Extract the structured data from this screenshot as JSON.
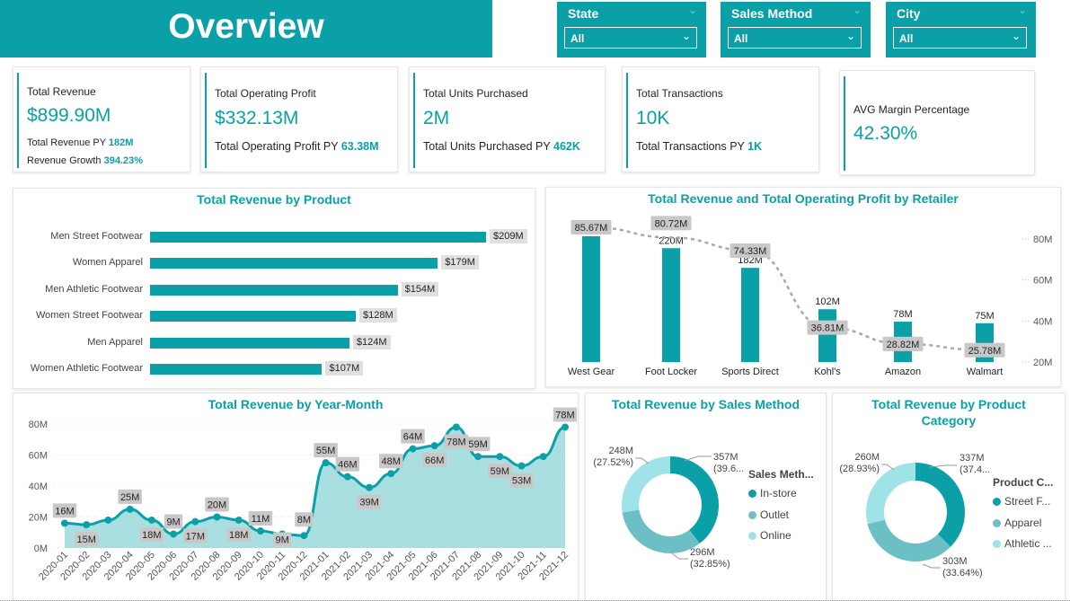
{
  "title": "Overview",
  "colors": {
    "accent": "#0ba0a7",
    "teal_mid": "#6cbfc4",
    "teal_light": "#9fe3e8",
    "label_bg": "#c8c8c8"
  },
  "filters": [
    {
      "label": "State",
      "value": "All"
    },
    {
      "label": "Sales Method",
      "value": "All"
    },
    {
      "label": "City",
      "value": "All"
    }
  ],
  "kpis": {
    "revenue": {
      "title": "Total Revenue",
      "value": "$899.90M",
      "sub1_label": "Total Revenue PY",
      "sub1_value": "182M",
      "sub2_label": "Revenue Growth",
      "sub2_value": "394.23%"
    },
    "profit": {
      "title": "Total Operating Profit",
      "value": "$332.13M",
      "sub_label": "Total Operating Profit PY",
      "sub_value": "63.38M"
    },
    "units": {
      "title": "Total Units Purchased",
      "value": "2M",
      "sub_label": "Total Units Purchased PY",
      "sub_value": "462K"
    },
    "transactions": {
      "title": "Total Transactions",
      "value": "10K",
      "sub_label": "Total Transactions PY",
      "sub_value": "1K"
    },
    "margin": {
      "title": "AVG Margin Percentage",
      "value": "42.30%"
    }
  },
  "chart_data": [
    {
      "type": "bar",
      "title": "Total Revenue by Product",
      "orientation": "horizontal",
      "categories": [
        "Men Street Footwear",
        "Women Apparel",
        "Men Athletic Footwear",
        "Women Street Footwear",
        "Men Apparel",
        "Women Athletic Footwear"
      ],
      "values": [
        209,
        179,
        154,
        128,
        124,
        107
      ],
      "labels": [
        "$209M",
        "$179M",
        "$154M",
        "$128M",
        "$124M",
        "$107M"
      ]
    },
    {
      "type": "bar",
      "title": "Total Revenue and Total Operating Profit by Retailer",
      "categories": [
        "West Gear",
        "Foot Locker",
        "Sports Direct",
        "Kohl's",
        "Amazon",
        "Walmart"
      ],
      "series": [
        {
          "values": [
            243,
            220,
            182,
            102,
            78,
            75
          ],
          "labels": [
            "243M",
            "220M",
            "182M",
            "102M",
            "78M",
            "75M"
          ]
        },
        {
          "values": [
            85.67,
            80.72,
            74.33,
            36.81,
            28.82,
            25.78
          ],
          "labels": [
            "85.67M",
            "80.72M",
            "74.33M",
            "36.81M",
            "28.82M",
            "25.78M"
          ]
        }
      ],
      "y2_ticks": [
        "80M",
        "60M",
        "40M",
        "20M"
      ],
      "y2lim": [
        20,
        80
      ]
    },
    {
      "type": "area",
      "title": "Total Revenue by Year-Month",
      "x": [
        "2020-01",
        "2020-02",
        "2020-03",
        "2020-04",
        "2020-05",
        "2020-06",
        "2020-07",
        "2020-08",
        "2020-09",
        "2020-10",
        "2020-11",
        "2020-12",
        "2021-01",
        "2021-02",
        "2021-03",
        "2021-04",
        "2021-05",
        "2021-06",
        "2021-07",
        "2021-08",
        "2021-09",
        "2021-10",
        "2021-11",
        "2021-12"
      ],
      "values": [
        16,
        15,
        18,
        25,
        18,
        9,
        17,
        20,
        18,
        11,
        9,
        8,
        55,
        46,
        39,
        48,
        64,
        66,
        78,
        59,
        59,
        53,
        59,
        78
      ],
      "labels": [
        "16M",
        "15M",
        "",
        "25M",
        "18M",
        "9M",
        "17M",
        "20M",
        "18M",
        "11M",
        "9M",
        "8M",
        "55M",
        "46M",
        "39M",
        "48M",
        "64M",
        "66M",
        "78M",
        "59M",
        "59M",
        "53M",
        "",
        "78M"
      ],
      "y_ticks": [
        "80M",
        "60M",
        "40M",
        "20M",
        "0M"
      ],
      "ylim": [
        0,
        80
      ]
    },
    {
      "type": "pie",
      "title": "Total Revenue by Sales Method",
      "legend_title": "Sales Meth...",
      "slices": [
        {
          "name": "In-store",
          "value": 357,
          "label": "357M",
          "pct": "(39.6...",
          "color": "#0ba0a7"
        },
        {
          "name": "Outlet",
          "value": 296,
          "label": "296M",
          "pct": "(32.85%)",
          "color": "#6cbfc4"
        },
        {
          "name": "Online",
          "value": 248,
          "label": "248M",
          "pct": "(27.52%)",
          "color": "#9fe3e8"
        }
      ]
    },
    {
      "type": "pie",
      "title_line1": "Total Revenue by Product",
      "title_line2": "Category",
      "legend_title": "Product C...",
      "slices": [
        {
          "name": "Street F...",
          "value": 337,
          "label": "337M",
          "pct": "(37.4...",
          "color": "#0ba0a7"
        },
        {
          "name": "Apparel",
          "value": 303,
          "label": "303M",
          "pct": "(33.64%)",
          "color": "#6cbfc4"
        },
        {
          "name": "Athletic ...",
          "value": 260,
          "label": "260M",
          "pct": "(28.93%)",
          "color": "#9fe3e8"
        }
      ]
    }
  ]
}
